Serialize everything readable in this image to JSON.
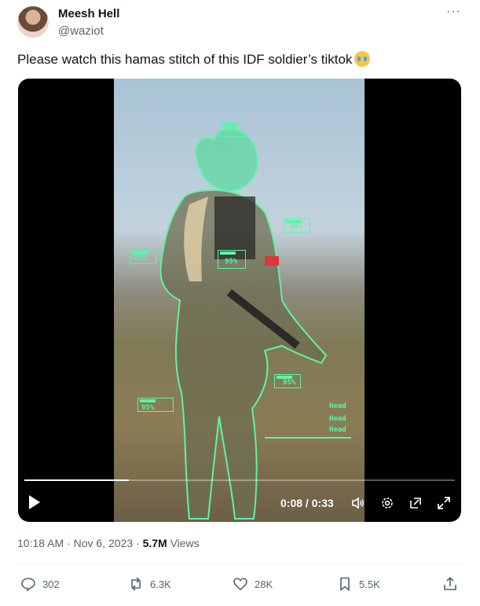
{
  "author": {
    "name": "Meesh Hell",
    "handle": "@waziot"
  },
  "tweet": {
    "text": "Please watch this hamas stitch of this IDF soldier’s tiktok"
  },
  "video": {
    "overlay_boxes": [
      "95%",
      "95%",
      "95%",
      "95%",
      "95%",
      "95%"
    ],
    "head_labels": [
      "Head",
      "Head",
      "Head"
    ],
    "current_time": "0:08",
    "duration": "0:33",
    "time_display": "0:08 / 0:33",
    "progress": 0.242
  },
  "meta": {
    "time": "10:18 AM",
    "date": "Nov 6, 2023",
    "views_count": "5.7M",
    "views_label": "Views"
  },
  "actions": {
    "replies": "302",
    "reposts": "6.3K",
    "likes": "28K",
    "bookmarks": "5.5K"
  },
  "icons": [
    "more-icon",
    "play-icon",
    "volume-icon",
    "settings-icon",
    "popout-icon",
    "fullscreen-icon",
    "reply-icon",
    "repost-icon",
    "like-icon",
    "bookmark-icon",
    "share-icon"
  ],
  "colors": {
    "overlay_green": "#5ff2a8",
    "text_secondary": "#536471"
  }
}
